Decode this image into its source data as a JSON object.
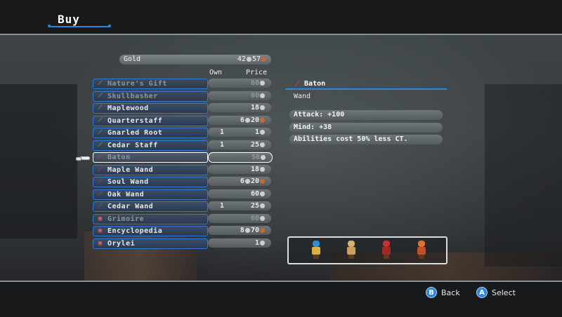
{
  "screen_title": "Buy",
  "gold": {
    "label": "Gold",
    "amount": "42 57"
  },
  "columns": {
    "own": "Own",
    "price": "Price"
  },
  "items": [
    {
      "name": "Nature's Gift",
      "own": "",
      "price": "60",
      "icon": "staff-icon",
      "dim": true
    },
    {
      "name": "Skullbasher",
      "own": "",
      "price": "60",
      "icon": "staff-icon",
      "dim": true
    },
    {
      "name": "Maplewood",
      "own": "",
      "price": "18",
      "icon": "staff-icon",
      "dim": false
    },
    {
      "name": "Quarterstaff",
      "own": "",
      "price": "6 20",
      "icon": "staff-icon",
      "dim": false
    },
    {
      "name": "Gnarled Root",
      "own": "1",
      "price": "1",
      "icon": "staff-icon",
      "dim": false
    },
    {
      "name": "Cedar Staff",
      "own": "1",
      "price": "25",
      "icon": "staff-icon",
      "dim": false
    },
    {
      "name": "Baton",
      "own": "",
      "price": "50",
      "icon": "wand-icon",
      "dim": true,
      "selected": true
    },
    {
      "name": "Maple Wand",
      "own": "",
      "price": "18",
      "icon": "wand-icon",
      "dim": false
    },
    {
      "name": "Soul Wand",
      "own": "",
      "price": "6 20",
      "icon": "wand-icon",
      "dim": false
    },
    {
      "name": "Oak Wand",
      "own": "",
      "price": "60",
      "icon": "wand-icon",
      "dim": false
    },
    {
      "name": "Cedar Wand",
      "own": "1",
      "price": "25",
      "icon": "wand-icon",
      "dim": false
    },
    {
      "name": "Grimoire",
      "own": "",
      "price": "60",
      "icon": "book-icon",
      "dim": true
    },
    {
      "name": "Encyclopedia",
      "own": "",
      "price": "8 70",
      "icon": "book-icon",
      "dim": false
    },
    {
      "name": "Orylei",
      "own": "",
      "price": "1",
      "icon": "book-icon",
      "dim": false
    }
  ],
  "detail": {
    "name": "Baton",
    "type": "Wand",
    "stats": [
      "Attack: +100",
      "Mind: +38",
      "Abilities cost 50% less CT."
    ]
  },
  "footer": {
    "back_key": "B",
    "back_label": "Back",
    "select_key": "A",
    "select_label": "Select"
  },
  "colors": {
    "accent": "#2f86d6",
    "bar": "#17191b"
  }
}
